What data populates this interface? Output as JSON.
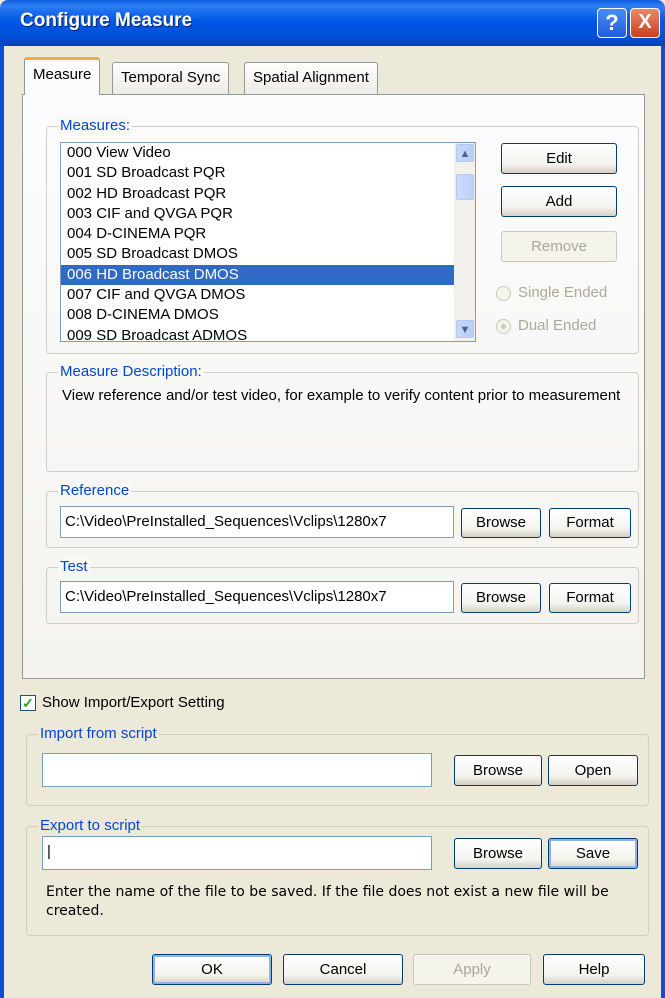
{
  "window": {
    "title": "Configure Measure",
    "help_glyph": "?",
    "close_glyph": "X"
  },
  "tabs": [
    {
      "label": "Measure",
      "active": true
    },
    {
      "label": "Temporal Sync",
      "active": false
    },
    {
      "label": "Spatial Alignment",
      "active": false
    }
  ],
  "measures": {
    "legend": "Measures:",
    "items": [
      "000 View Video",
      "001 SD Broadcast PQR",
      "002 HD Broadcast PQR",
      "003 CIF and QVGA PQR",
      "004 D-CINEMA PQR",
      "005 SD Broadcast DMOS",
      "006 HD Broadcast DMOS",
      "007 CIF and QVGA DMOS",
      "008 D-CINEMA DMOS",
      "009 SD Broadcast ADMOS"
    ],
    "selected_index": 6,
    "edit_label": "Edit",
    "add_label": "Add",
    "remove_label": "Remove",
    "single_ended_label": "Single Ended",
    "dual_ended_label": "Dual Ended",
    "dual_ended_selected": true
  },
  "description": {
    "legend": "Measure Description:",
    "text": "View reference and/or test video, for example to verify content prior to measurement"
  },
  "reference": {
    "legend": "Reference",
    "path": "C:\\Video\\PreInstalled_Sequences\\Vclips\\1280x7",
    "browse_label": "Browse",
    "format_label": "Format"
  },
  "test": {
    "legend": "Test",
    "path": "C:\\Video\\PreInstalled_Sequences\\Vclips\\1280x7",
    "browse_label": "Browse",
    "format_label": "Format"
  },
  "import_export": {
    "checkbox_label": "Show Import/Export Setting",
    "checked": true,
    "import_legend": "Import from script",
    "import_value": "",
    "import_browse_label": "Browse",
    "import_open_label": "Open",
    "export_legend": "Export to script",
    "export_value": "|",
    "export_browse_label": "Browse",
    "export_save_label": "Save",
    "export_hint": "Enter the name of the file to be saved. If the file does not exist a new file will be created."
  },
  "footer": {
    "ok_label": "OK",
    "cancel_label": "Cancel",
    "apply_label": "Apply",
    "help_label": "Help"
  },
  "colors": {
    "title_bar": "#0058e6",
    "selection": "#316ac5",
    "group_legend": "#0046d5"
  }
}
